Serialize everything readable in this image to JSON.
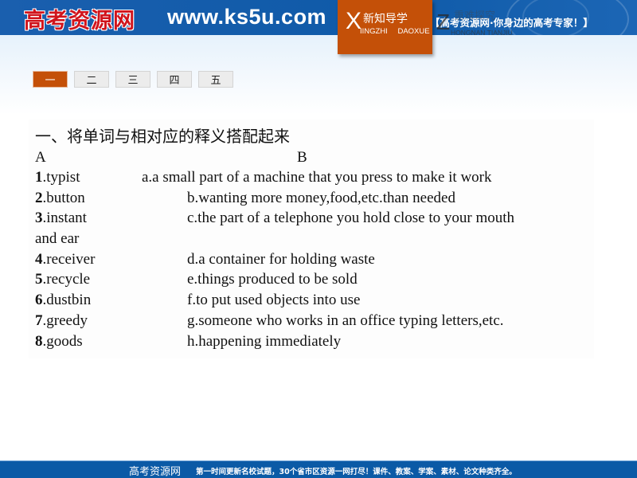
{
  "header": {
    "logo_cn": "高考资源网",
    "logo_url": "www.ks5u.com",
    "slogan": "【高考资源网·你身边的高考专家！】",
    "section_tag": {
      "letter": "X",
      "title": "新知导学",
      "pinyin": "IINGZHI DAOXUE"
    },
    "ghost_tag": {
      "letter": "Z",
      "title": "重难探究",
      "pinyin": "HONGNAN TIANJIU"
    }
  },
  "tabs": [
    {
      "label": "一",
      "active": true
    },
    {
      "label": "二",
      "active": false
    },
    {
      "label": "三",
      "active": false
    },
    {
      "label": "四",
      "active": false
    },
    {
      "label": "五",
      "active": false
    }
  ],
  "exercise": {
    "title": "一、将单词与相对应的释义搭配起来",
    "column_a": "A",
    "column_b": "B",
    "words": [
      {
        "num": "1",
        "word": ".typist"
      },
      {
        "num": "2",
        "word": ".button"
      },
      {
        "num": "3",
        "word": ".instant"
      },
      {
        "num": "4",
        "word": ".receiver"
      },
      {
        "num": "5",
        "word": ".recycle"
      },
      {
        "num": "6",
        "word": ".dustbin"
      },
      {
        "num": "7",
        "word": ".greedy"
      },
      {
        "num": "8",
        "word": ".goods"
      }
    ],
    "definitions": [
      "a.a small part of a machine that you press to make it work",
      "b.wanting more money,food,etc.than needed",
      "c.the part of a telephone you hold close to your mouth",
      "d.a container for holding waste",
      "e.things produced to be sold",
      "f.to put used objects into use",
      "g.someone who works in an office typing letters,etc.",
      "h.happening immediately"
    ],
    "continuation": "and ear"
  },
  "footer": {
    "brand": "高考资源网",
    "text": "第一时间更新名校试题，30个省市区资源一网打尽！课件、教案、学案、素材、论文种类齐全。"
  },
  "colors": {
    "header_blue": "#0f5aa8",
    "accent_orange": "#c45008",
    "logo_red": "#d0141c"
  }
}
